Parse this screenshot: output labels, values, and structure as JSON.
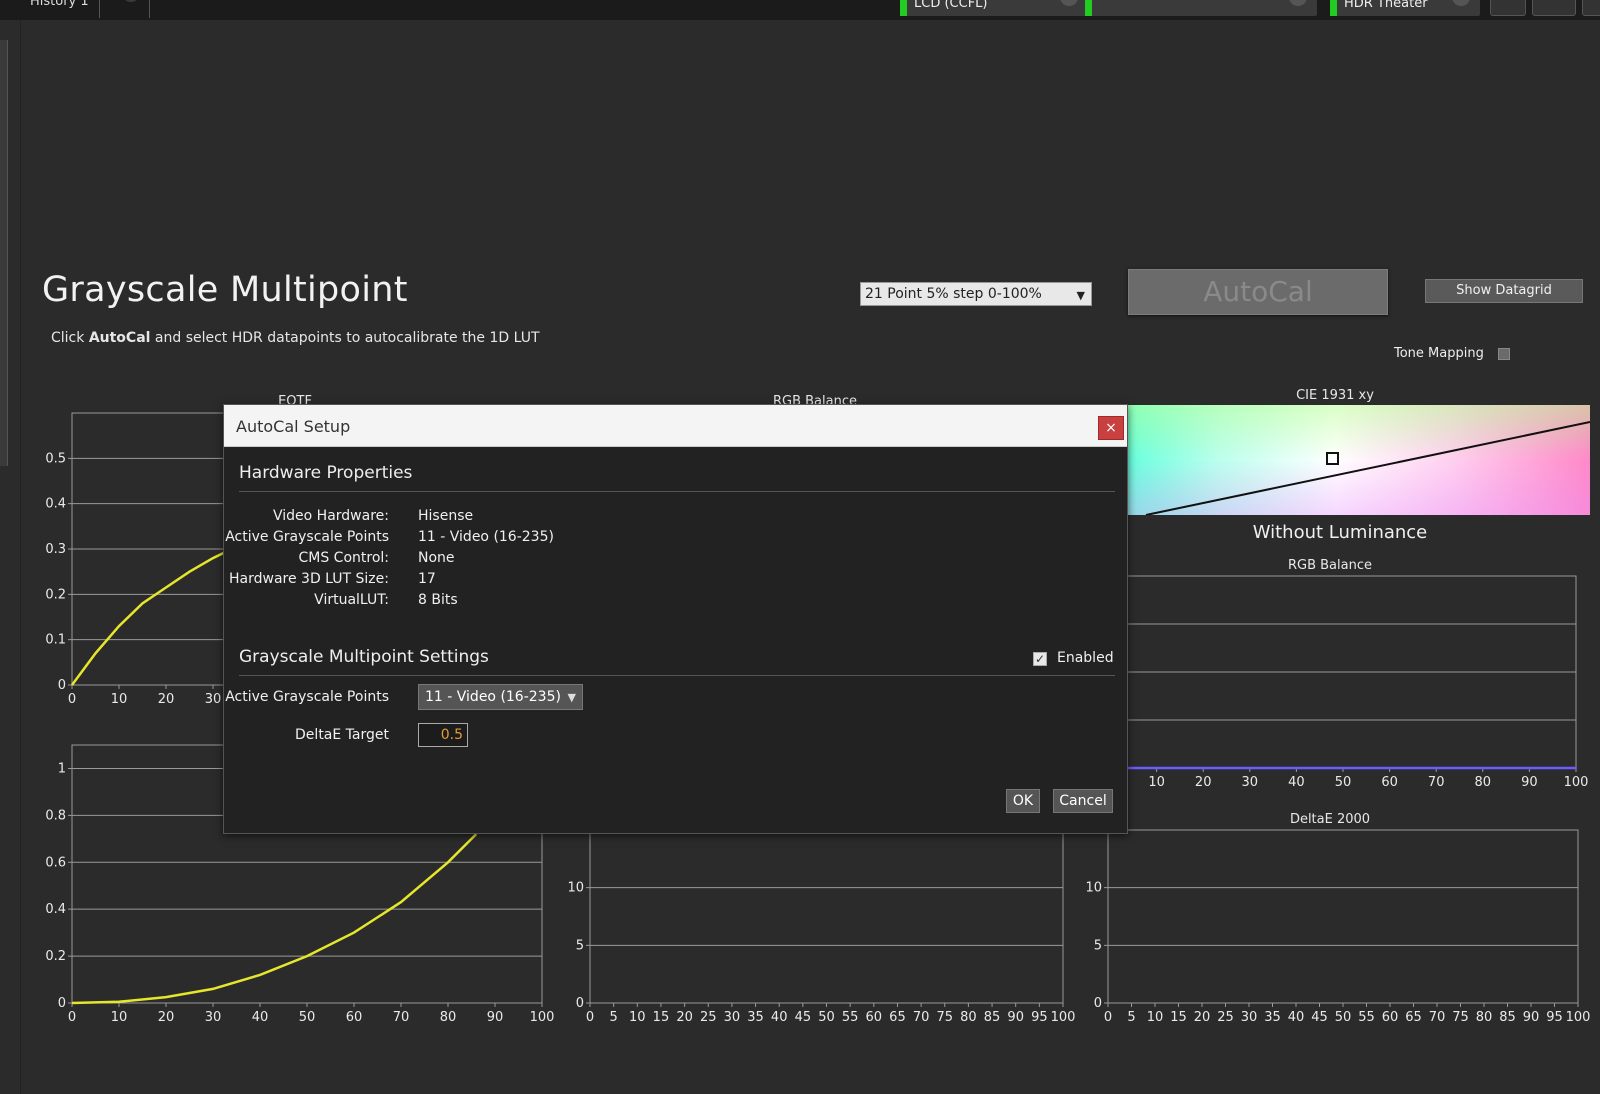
{
  "topbar": {
    "history_tab": "History 1",
    "add_tab": "+",
    "display_type": "LCD (CCFL)",
    "middle_select": "",
    "picture_mode": "HDR Theater"
  },
  "page": {
    "title": "Grayscale Multipoint",
    "subtitle_prefix": "Click ",
    "subtitle_bold": "AutoCal",
    "subtitle_suffix": " and select HDR datapoints to autocalibrate the 1D LUT",
    "point_select": "21 Point 5% step 0-100%",
    "autocal_label": "AutoCal",
    "datagrid_label": "Show Datagrid",
    "tone_mapping_label": "Tone Mapping",
    "tone_mapping_checked": false
  },
  "charts": {
    "eotf_title": "EOTF",
    "rgb_balance_title": "RGB Balance",
    "cie_title": "CIE 1931 xy",
    "without_luminance": "Without Luminance",
    "rgb_balance_right_title": "RGB Balance",
    "deltae_title": "DeltaE 2000"
  },
  "chart_data": [
    {
      "type": "line",
      "title": "EOTF",
      "x_ticks": [
        0,
        10,
        20,
        30
      ],
      "y_ticks": [
        0,
        0.1,
        0.2,
        0.3,
        0.4,
        0.5
      ],
      "series": [
        {
          "color": "#e6e62a",
          "x": [
            0,
            5,
            10,
            15,
            20,
            25,
            30,
            33
          ],
          "y": [
            0,
            0.07,
            0.13,
            0.18,
            0.215,
            0.25,
            0.28,
            0.295
          ]
        }
      ]
    },
    {
      "type": "line",
      "title": "",
      "x_ticks": [
        0,
        10,
        20,
        30,
        40,
        50,
        60,
        70,
        80,
        90,
        100
      ],
      "y_ticks": [
        0,
        0.2,
        0.4,
        0.6,
        0.8,
        1
      ],
      "series": [
        {
          "color": "#e6e62a",
          "x": [
            0,
            10,
            20,
            30,
            40,
            50,
            60,
            70,
            80,
            86
          ],
          "y": [
            0,
            0.005,
            0.025,
            0.06,
            0.12,
            0.2,
            0.3,
            0.43,
            0.6,
            0.72
          ]
        }
      ]
    },
    {
      "type": "line",
      "title": "",
      "x_ticks": [
        0,
        5,
        10,
        15,
        20,
        25,
        30,
        35,
        40,
        45,
        50,
        55,
        60,
        65,
        70,
        75,
        80,
        85,
        90,
        95,
        100
      ],
      "y_ticks": [
        0,
        5,
        10
      ],
      "series": []
    },
    {
      "type": "line",
      "title": "RGB Balance",
      "x_ticks": [
        10,
        20,
        30,
        40,
        50,
        60,
        70,
        80,
        90,
        100
      ],
      "series": [
        {
          "color": "#6a5cff",
          "x": [
            0,
            100
          ],
          "y": [
            0,
            0
          ]
        }
      ]
    },
    {
      "type": "line",
      "title": "DeltaE 2000",
      "x_ticks": [
        0,
        5,
        10,
        15,
        20,
        25,
        30,
        35,
        40,
        45,
        50,
        55,
        60,
        65,
        70,
        75,
        80,
        85,
        90,
        95,
        100
      ],
      "y_ticks": [
        0,
        5,
        10
      ],
      "series": []
    }
  ],
  "modal": {
    "title": "AutoCal Setup",
    "close_label": "×",
    "hardware_section": "Hardware Properties",
    "props": [
      {
        "label": "Video Hardware:",
        "value": "Hisense"
      },
      {
        "label": "Active Grayscale Points",
        "value": "11 - Video (16-235)"
      },
      {
        "label": "CMS Control:",
        "value": "None"
      },
      {
        "label": "Hardware 3D LUT Size:",
        "value": "17"
      },
      {
        "label": "VirtualLUT:",
        "value": "8 Bits"
      }
    ],
    "settings_section": "Grayscale Multipoint Settings",
    "enabled_label": "Enabled",
    "enabled_checked": true,
    "active_points_label": "Active Grayscale Points",
    "active_points_value": "11 - Video (16-235)",
    "deltae_label": "DeltaE Target",
    "deltae_value": "0.5",
    "ok_label": "OK",
    "cancel_label": "Cancel"
  },
  "colors": {
    "background": "#2b2b2b",
    "curve": "#e6e62a",
    "led": "#22cc22",
    "close": "#c84040",
    "deltae_value": "#e59a3a"
  }
}
